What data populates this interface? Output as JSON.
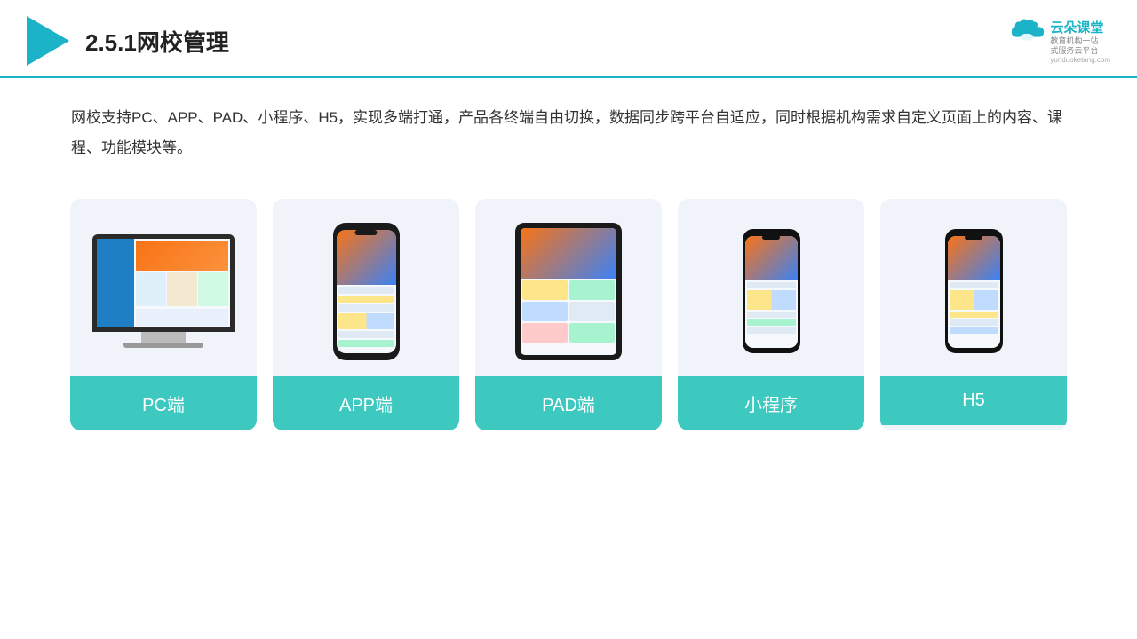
{
  "header": {
    "title": "2.5.1网校管理",
    "brand": {
      "name": "云朵课堂",
      "tagline": "教育机构一站\n式服务云平台",
      "url": "yunduoketang.com"
    }
  },
  "description": {
    "text": "网校支持PC、APP、PAD、小程序、H5，实现多端打通，产品各终端自由切换，数据同步跨平台自适应，同时根据机构需求自定义页面上的内容、课程、功能模块等。"
  },
  "cards": [
    {
      "id": "pc",
      "label": "PC端"
    },
    {
      "id": "app",
      "label": "APP端"
    },
    {
      "id": "pad",
      "label": "PAD端"
    },
    {
      "id": "miniapp",
      "label": "小程序"
    },
    {
      "id": "h5",
      "label": "H5"
    }
  ],
  "colors": {
    "accent": "#3dc8c0",
    "header_line": "#1ab3c8",
    "brand_blue": "#1ab3c8"
  }
}
